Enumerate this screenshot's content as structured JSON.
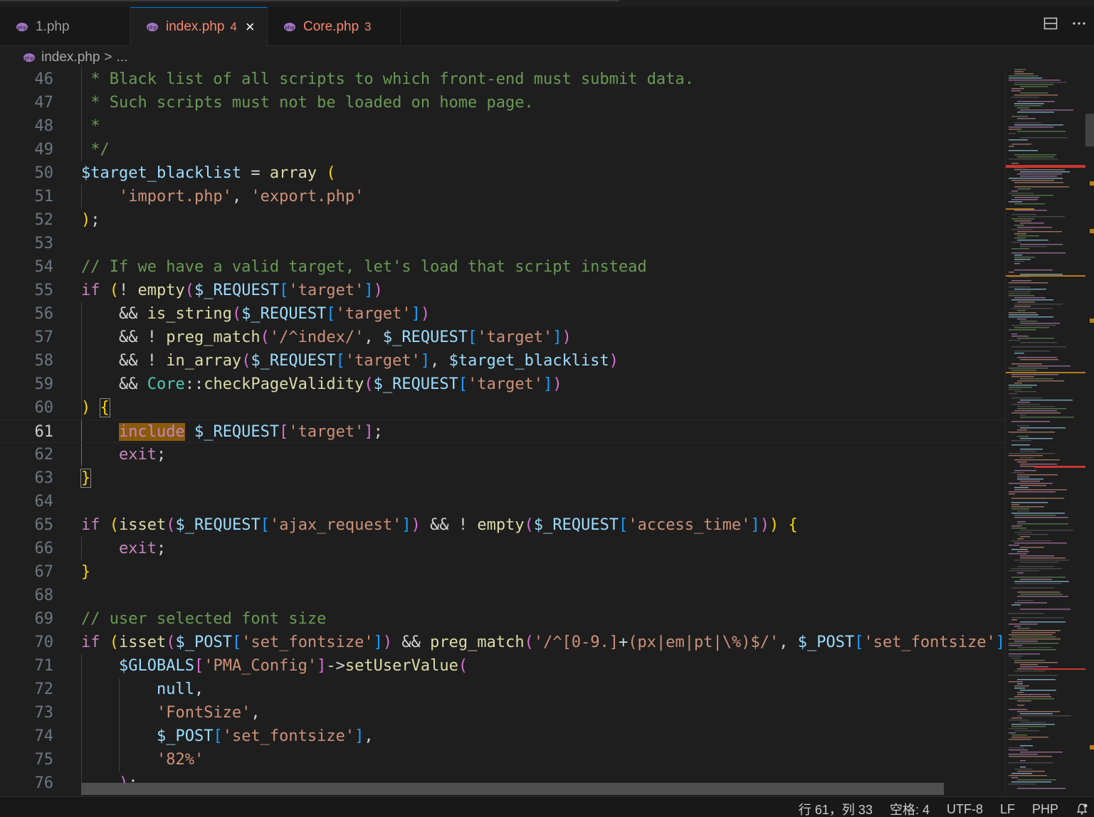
{
  "tabs": [
    {
      "label": "1.php",
      "count": "",
      "error": false,
      "active": false
    },
    {
      "label": "index.php",
      "count": "4",
      "error": true,
      "active": true
    },
    {
      "label": "Core.php",
      "count": "3",
      "error": true,
      "active": false
    }
  ],
  "tab_actions": [
    {
      "icon": "split-editor-icon"
    },
    {
      "icon": "more-actions-icon"
    }
  ],
  "breadcrumb": {
    "file": "index.php",
    "separator": ">",
    "tail": "..."
  },
  "editor": {
    "current_line": "61",
    "line_numbers": [
      "46",
      "47",
      "48",
      "49",
      "50",
      "51",
      "52",
      "53",
      "54",
      "55",
      "56",
      "57",
      "58",
      "59",
      "60",
      "61",
      "62",
      "63",
      "64",
      "65",
      "66",
      "67",
      "68",
      "69",
      "70",
      "71",
      "72",
      "73",
      "74",
      "75",
      "76"
    ],
    "colors": {
      "comment": "#6a9955",
      "variable": "#9cdcfe",
      "keyword": "#c586c0",
      "function": "#dcdcaa",
      "string": "#ce9178",
      "class": "#4ec9b0",
      "highlight": "#8a5a0b"
    }
  },
  "status": {
    "position": "行 61，列 33",
    "indent": "空格: 4",
    "encoding": "UTF-8",
    "eol": "LF",
    "language": "PHP",
    "bell_icon": "bell-icon"
  }
}
